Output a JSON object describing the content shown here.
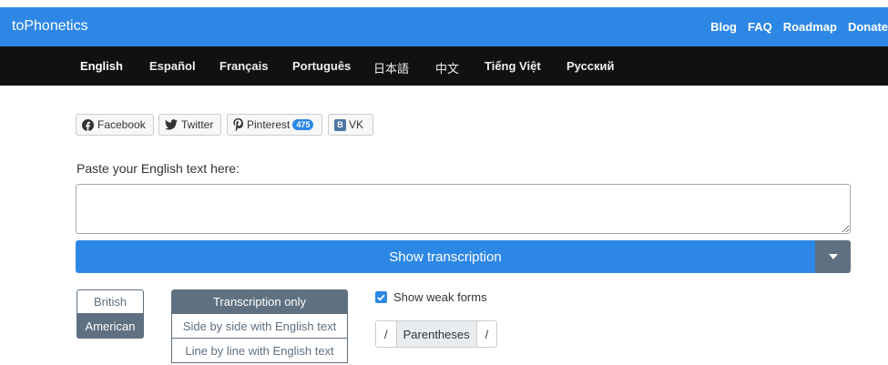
{
  "header": {
    "brand": "toPhonetics",
    "links": [
      "Blog",
      "FAQ",
      "Roadmap",
      "Donate"
    ]
  },
  "languages": {
    "items": [
      "English",
      "Español",
      "Français",
      "Português",
      "日本語",
      "中文",
      "Tiếng Việt",
      "Русский"
    ],
    "active": "English"
  },
  "social": {
    "facebook": "Facebook",
    "twitter": "Twitter",
    "pinterest": "Pinterest",
    "pinterest_count": "475",
    "vk": "VK"
  },
  "main": {
    "prompt": "Paste your English text here:",
    "textarea_value": "",
    "show_button": "Show transcription"
  },
  "accent": {
    "options": [
      "British",
      "American"
    ],
    "selected": "American"
  },
  "mode": {
    "options": [
      "Transcription only",
      "Side by side with English text",
      "Line by line with English text"
    ],
    "selected": "Transcription only"
  },
  "weak_forms": {
    "label": "Show weak forms",
    "checked": true
  },
  "brackets": {
    "left": "/",
    "middle": "Parentheses",
    "right": "/"
  },
  "colors": {
    "primary": "#2d87e5",
    "dark_bar": "#111111",
    "secondary": "#5f7080"
  }
}
